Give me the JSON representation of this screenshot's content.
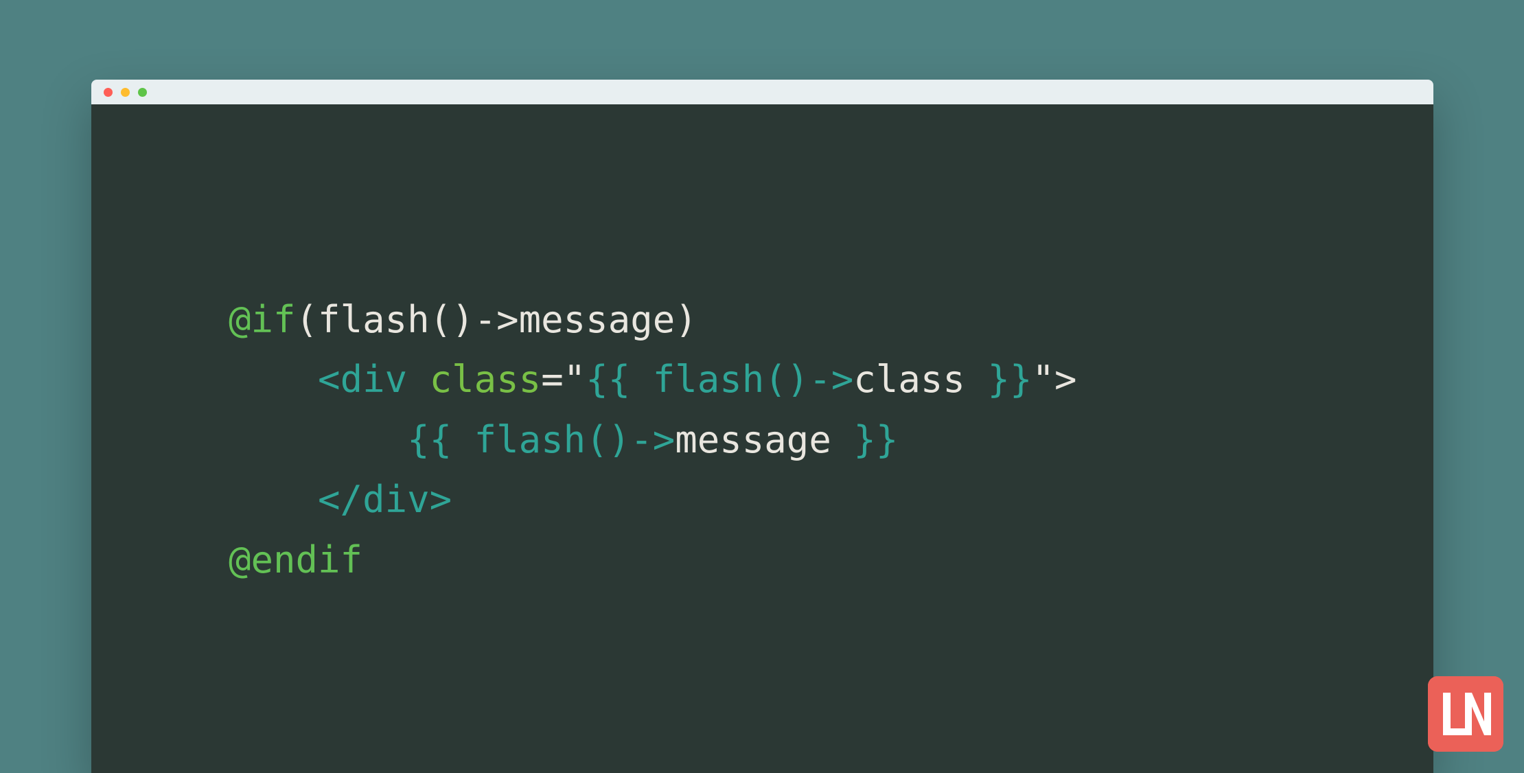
{
  "colors": {
    "page_bg": "#4f8182",
    "titlebar_bg": "#e8eff1",
    "editor_bg": "#2b3834",
    "dot_red": "#fe5f57",
    "dot_yellow": "#febc2e",
    "dot_green": "#5ec448",
    "syntax_directive": "#63c155",
    "syntax_tag": "#2fa597",
    "syntax_attr": "#79c046",
    "syntax_text": "#e9e6df",
    "logo_bg": "#eb6158"
  },
  "traffic_lights": [
    "close",
    "minimize",
    "zoom"
  ],
  "code": {
    "line1": {
      "dir": "@if",
      "rest": "(flash()->message)"
    },
    "line2": {
      "indent": "    ",
      "open_lt": "<",
      "tag": "div",
      "space": " ",
      "attr": "class",
      "eq_quote": "=\"",
      "blade_open": "{{ ",
      "expr_fn": "flash()->",
      "expr_prop": "class",
      "blade_close": " }}",
      "quote_gt": "\">"
    },
    "line3": {
      "indent": "        ",
      "blade_open": "{{ ",
      "expr_fn": "flash()->",
      "expr_prop": "message",
      "blade_close": " }}"
    },
    "line4": {
      "indent": "    ",
      "open": "</",
      "tag": "div",
      "close": ">"
    },
    "line5": {
      "dir": "@endif"
    }
  },
  "logo_text": "LN"
}
